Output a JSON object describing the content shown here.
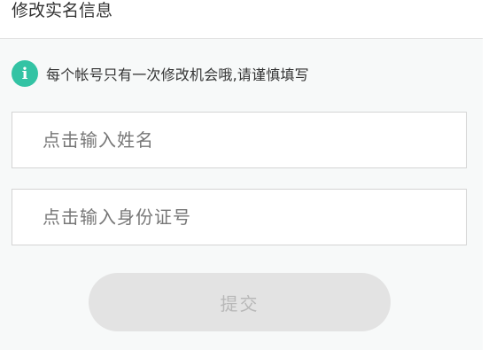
{
  "header": {
    "title": "修改实名信息"
  },
  "notice": {
    "icon": "info-icon",
    "icon_glyph": "i",
    "icon_color": "#33c3a4",
    "text": "每个帐号只有一次修改机会哦,请谨慎填写"
  },
  "form": {
    "name_field": {
      "placeholder": "点击输入姓名",
      "value": ""
    },
    "id_field": {
      "placeholder": "点击输入身份证号",
      "value": ""
    },
    "submit_label": "提交"
  }
}
